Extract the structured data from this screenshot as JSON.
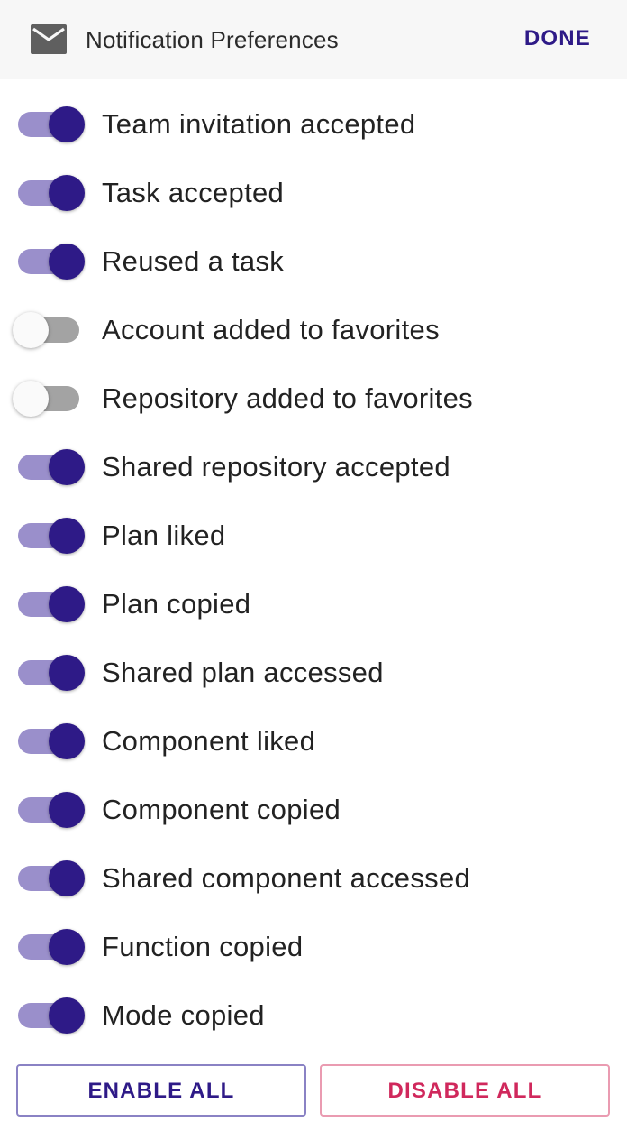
{
  "header": {
    "icon": "mail-icon",
    "title": "Notification Preferences",
    "done_label": "DONE"
  },
  "colors": {
    "accent": "#2e1a87",
    "track_on": "#9a8fcb",
    "track_off": "#a3a3a3",
    "danger": "#d0285c"
  },
  "preferences": [
    {
      "label": "Team invitation accepted",
      "enabled": true
    },
    {
      "label": "Task accepted",
      "enabled": true
    },
    {
      "label": "Reused a task",
      "enabled": true
    },
    {
      "label": "Account added to favorites",
      "enabled": false
    },
    {
      "label": "Repository added to favorites",
      "enabled": false
    },
    {
      "label": "Shared repository accepted",
      "enabled": true
    },
    {
      "label": "Plan liked",
      "enabled": true
    },
    {
      "label": "Plan copied",
      "enabled": true
    },
    {
      "label": "Shared plan accessed",
      "enabled": true
    },
    {
      "label": "Component liked",
      "enabled": true
    },
    {
      "label": "Component copied",
      "enabled": true
    },
    {
      "label": "Shared component accessed",
      "enabled": true
    },
    {
      "label": "Function copied",
      "enabled": true
    },
    {
      "label": "Mode copied",
      "enabled": true
    }
  ],
  "footer": {
    "enable_all_label": "ENABLE ALL",
    "disable_all_label": "DISABLE ALL"
  }
}
